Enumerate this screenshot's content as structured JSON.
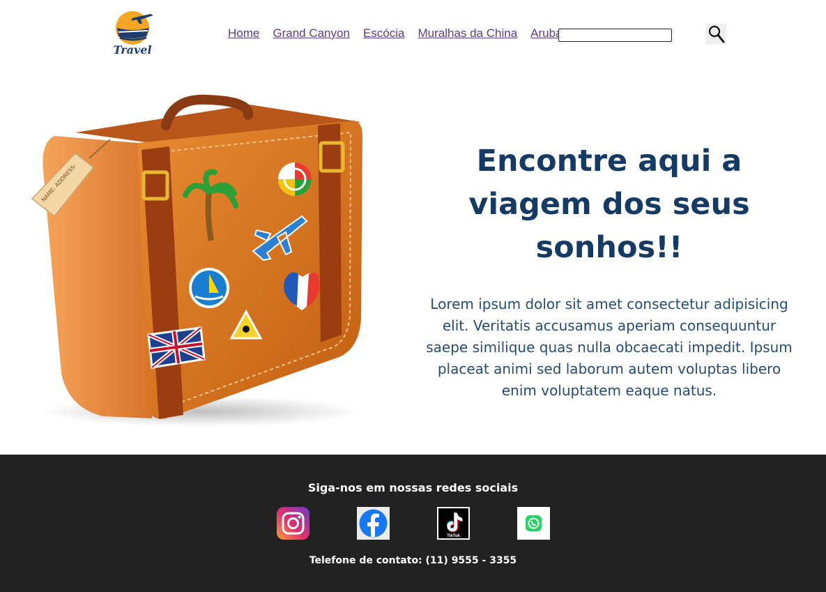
{
  "header": {
    "logo_text": "Travel",
    "nav": [
      {
        "label": "Home"
      },
      {
        "label": "Grand Canyon"
      },
      {
        "label": "Escócia"
      },
      {
        "label": "Muralhas da China"
      },
      {
        "label": "Aruba"
      }
    ],
    "search": {
      "value": "",
      "placeholder": ""
    },
    "search_icon": "magnifier-icon"
  },
  "hero": {
    "title": "Encontre aqui a viagem dos seus sonhos!!",
    "body": "Lorem ipsum dolor sit amet consectetur adipisicing elit. Veritatis accusamus aperiam consequuntur saepe similique quas nulla obcaecati impedit. Ipsum placeat animi sed laborum autem voluptas libero enim voluptatem eaque natus.",
    "image": "suitcase-with-stickers",
    "tag_text": "NAME: ADDRESS:"
  },
  "footer": {
    "title": "Siga-nos em nossas redes sociais",
    "social": [
      {
        "name": "instagram-icon"
      },
      {
        "name": "facebook-icon"
      },
      {
        "name": "tiktok-icon",
        "label": "TikTok"
      },
      {
        "name": "whatsapp-icon"
      }
    ],
    "phone": "Telefone de contato: (11) 9555 - 3355"
  },
  "colors": {
    "title": "#153a63",
    "body": "#274b70",
    "footer_bg": "#222222",
    "link": "#5a3a8a"
  }
}
